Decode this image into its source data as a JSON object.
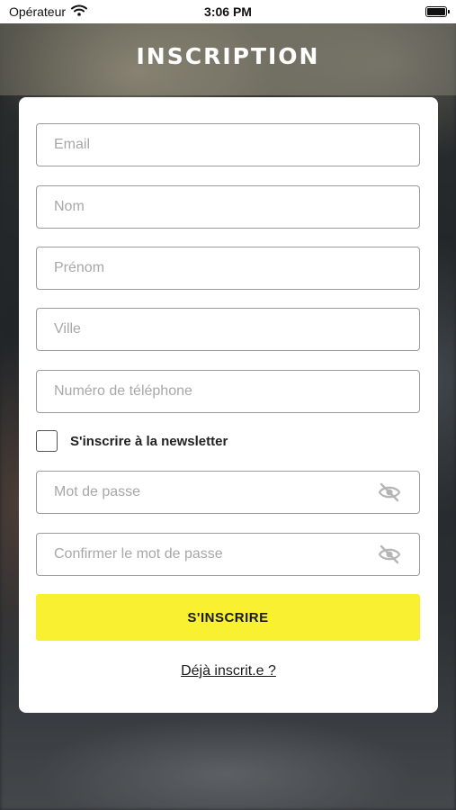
{
  "status_bar": {
    "carrier": "Opérateur",
    "time": "3:06 PM"
  },
  "header": {
    "title": "INSCRIPTION"
  },
  "form": {
    "email_placeholder": "Email",
    "nom_placeholder": "Nom",
    "prenom_placeholder": "Prénom",
    "ville_placeholder": "Ville",
    "telephone_placeholder": "Numéro de téléphone",
    "newsletter_label": "S'inscrire à la newsletter",
    "newsletter_checked": false,
    "password_placeholder": "Mot de passe",
    "confirm_password_placeholder": "Confirmer le mot de passe",
    "submit_label": "S'INSCRIRE",
    "login_link": "Déjà inscrit.e ?"
  },
  "colors": {
    "accent": "#f8f030",
    "card": "#ffffff",
    "placeholder": "#a7a7a7",
    "border": "#9a9a9a"
  },
  "icons": {
    "wifi": "wifi-icon",
    "battery": "battery-icon",
    "password_toggle": "eye-off-icon"
  }
}
